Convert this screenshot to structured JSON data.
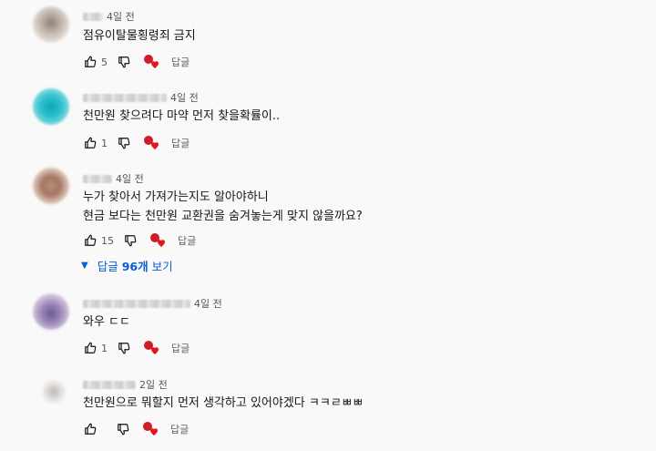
{
  "labels": {
    "reply": "답글"
  },
  "comments": [
    {
      "time": "4일 전",
      "lines": [
        "점유이탈물횡령죄 금지"
      ],
      "likes": "5"
    },
    {
      "time": "4일 전",
      "lines": [
        "천만원 찾으려다 마약 먼저 찾을확률이.."
      ],
      "likes": "1"
    },
    {
      "time": "4일 전",
      "lines": [
        "누가 찾아서 가져가는지도 알아야하니",
        "현금 보다는 천만원 교환권을 숨겨놓는게 맞지 않을까요?"
      ],
      "likes": "15",
      "replies": {
        "prefix": "답글",
        "count": "96개",
        "suffix": "보기"
      }
    },
    {
      "time": "4일 전",
      "lines": [
        "와우 ㄷㄷ"
      ],
      "likes": "1"
    },
    {
      "time": "2일 전",
      "lines": [
        "천만원으로 뭐할지 먼저 생각하고 있어야겠다 ㅋㅋㄹㅃㅃ"
      ],
      "likes": ""
    }
  ],
  "colors": {
    "link": "#065fd4",
    "heart": "#e8121b",
    "badge": "#cc1d2a"
  }
}
